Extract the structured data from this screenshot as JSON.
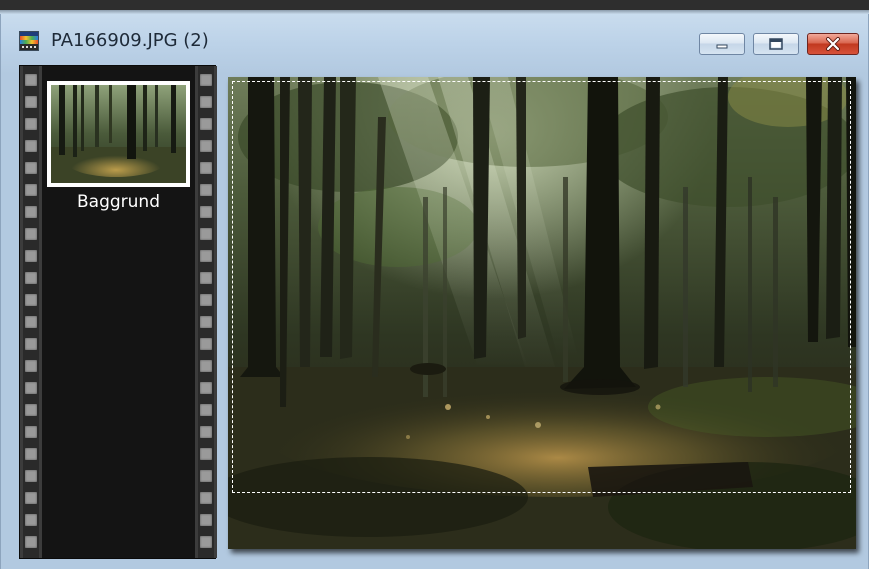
{
  "window": {
    "title": "PA166909.JPG (2)",
    "icon": "image-film-icon"
  },
  "controls": {
    "minimize_icon": "minimize-icon",
    "maximize_icon": "maximize-icon",
    "close_icon": "close-icon",
    "close_color": "#c1391f"
  },
  "filmstrip": {
    "layers": [
      {
        "label": "Baggrund",
        "selected": true
      }
    ]
  },
  "canvas": {
    "content": "forest-photo",
    "selection_marquee": true
  }
}
